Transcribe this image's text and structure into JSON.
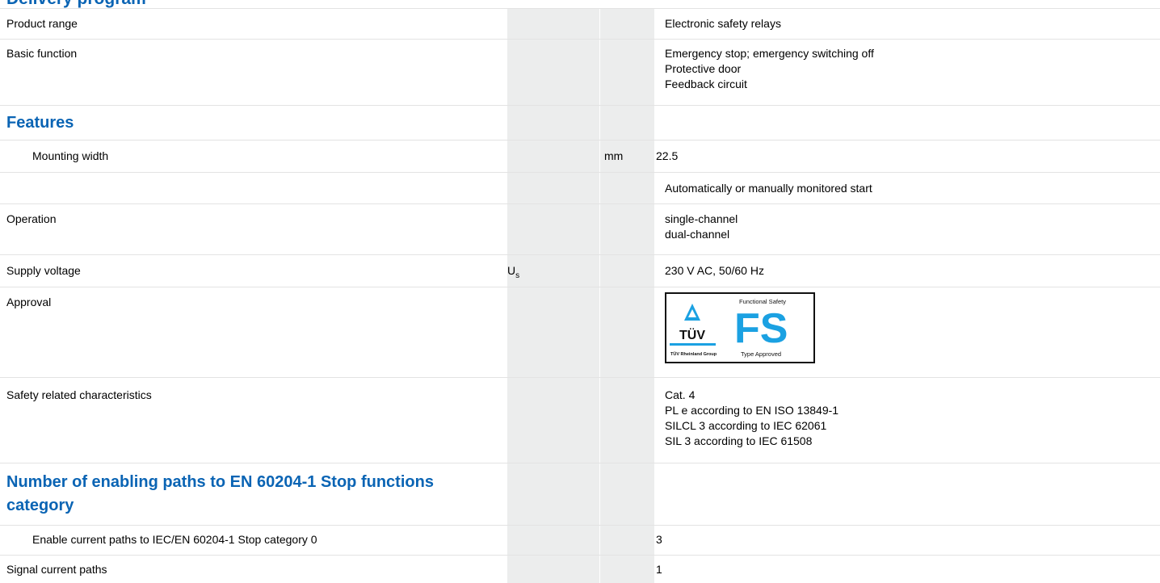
{
  "top_heading": "Delivery program",
  "rows": [
    {
      "label": "Product range",
      "values": [
        "Electronic safety relays"
      ]
    },
    {
      "label": "Basic function",
      "values": [
        "Emergency stop; emergency switching off",
        "Protective door",
        "Feedback circuit"
      ]
    },
    {
      "section": "Features"
    },
    {
      "label": "Mounting width",
      "unit": "mm",
      "values": [
        "22.5"
      ]
    },
    {
      "label": "",
      "values": [
        "Automatically or manually monitored start"
      ]
    },
    {
      "label": "Operation",
      "values": [
        "single-channel",
        "dual-channel"
      ]
    },
    {
      "label": "Supply voltage",
      "symbol": "U",
      "symbol_sub": "s",
      "values": [
        "230 V AC, 50/60 Hz"
      ]
    },
    {
      "label": "Approval",
      "badge": {
        "heading": "Functional Safety",
        "letters": "FS",
        "mark": "TÜV",
        "group": "TÜV Rheinland Group",
        "caption": "Type Approved"
      }
    },
    {
      "label": "Safety related characteristics",
      "values": [
        "Cat. 4",
        "PL e according to EN ISO 13849-1",
        "SILCL 3 according to IEC 62061",
        "SIL 3 according to IEC 61508"
      ]
    },
    {
      "section_lines": [
        "Number of enabling paths to EN 60204-1 Stop functions",
        "category"
      ]
    },
    {
      "label": "Enable current paths to IEC/EN 60204-1 Stop category 0",
      "values": [
        "3"
      ]
    },
    {
      "label": "Signal current paths",
      "values": [
        "1"
      ]
    }
  ],
  "colors": {
    "heading_blue": "#0a64b4",
    "badge_blue": "#1ba1e2",
    "shade": "#eceded"
  }
}
